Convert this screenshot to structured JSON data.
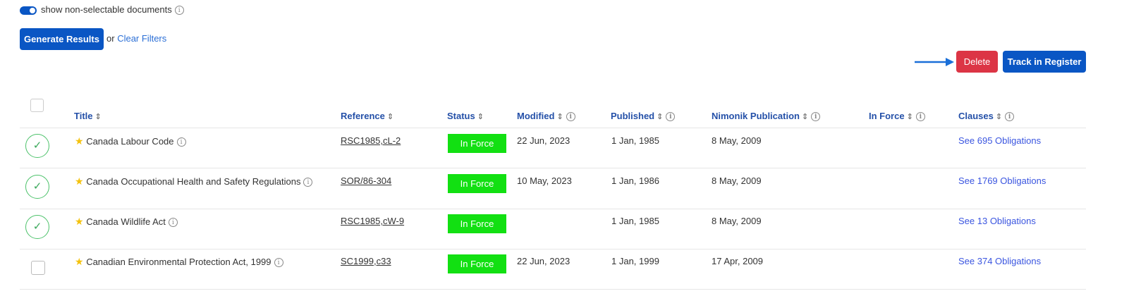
{
  "filters": {
    "toggle_label": "show non-selectable documents",
    "generate_label": "Generate Results",
    "or_text": "or",
    "clear_label": "Clear Filters"
  },
  "actions": {
    "delete_label": "Delete",
    "track_label": "Track in Register",
    "delete_color": "#dc3545",
    "primary_color": "#0a56c4"
  },
  "table": {
    "headers": {
      "title": "Title",
      "reference": "Reference",
      "status": "Status",
      "modified": "Modified",
      "published": "Published",
      "nimonik": "Nimonik Publication",
      "in_force": "In Force",
      "clauses": "Clauses"
    },
    "rows": [
      {
        "selected": true,
        "title": "Canada Labour Code",
        "reference": "RSC1985,cL-2",
        "status": "In Force",
        "modified": "22 Jun, 2023",
        "published": "1 Jan, 1985",
        "nimonik": "8 May, 2009",
        "in_force": "",
        "clauses": "See 695 Obligations"
      },
      {
        "selected": true,
        "title": "Canada Occupational Health and Safety Regulations",
        "reference": "SOR/86-304",
        "status": "In Force",
        "modified": "10 May, 2023",
        "published": "1 Jan, 1986",
        "nimonik": "8 May, 2009",
        "in_force": "",
        "clauses": "See 1769 Obligations"
      },
      {
        "selected": true,
        "title": "Canada Wildlife Act",
        "reference": "RSC1985,cW-9",
        "status": "In Force",
        "modified": "",
        "published": "1 Jan, 1985",
        "nimonik": "8 May, 2009",
        "in_force": "",
        "clauses": "See 13 Obligations"
      },
      {
        "selected": false,
        "title": "Canadian Environmental Protection Act, 1999",
        "reference": "SC1999,c33",
        "status": "In Force",
        "modified": "22 Jun, 2023",
        "published": "1 Jan, 1999",
        "nimonik": "17 Apr, 2009",
        "in_force": "",
        "clauses": "See 374 Obligations"
      }
    ]
  }
}
